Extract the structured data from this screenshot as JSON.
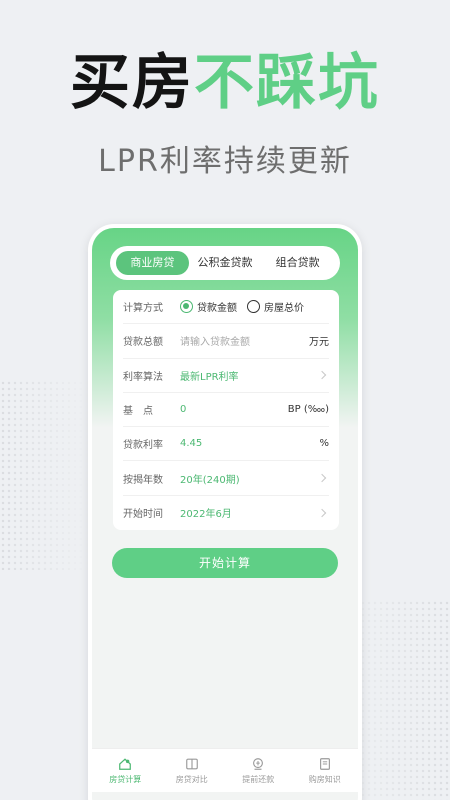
{
  "headline": {
    "part1": "买房",
    "part2": "不踩坑"
  },
  "subheadline": "LPR利率持续更新",
  "colors": {
    "accent": "#5fcf86",
    "accent_dark": "#4cb872",
    "background": "#eef0f3"
  },
  "tabs": [
    {
      "label": "商业房贷",
      "active": true
    },
    {
      "label": "公积金贷款",
      "active": false
    },
    {
      "label": "组合贷款",
      "active": false
    }
  ],
  "form": {
    "calc_method": {
      "label": "计算方式",
      "options": [
        {
          "label": "贷款金额",
          "selected": true
        },
        {
          "label": "房屋总价",
          "selected": false
        }
      ]
    },
    "loan_total": {
      "label": "贷款总额",
      "placeholder": "请输入贷款金额",
      "unit": "万元"
    },
    "rate_algo": {
      "label": "利率算法",
      "value": "最新LPR利率"
    },
    "basis_point": {
      "label": "基　点",
      "value": "0",
      "unit": "BP (‱)"
    },
    "loan_rate": {
      "label": "贷款利率",
      "value": "4.45",
      "unit": "%"
    },
    "years": {
      "label": "按揭年数",
      "value": "20年(240期)"
    },
    "start_time": {
      "label": "开始时间",
      "value": "2022年6月"
    }
  },
  "start_button": "开始计算",
  "bottom_nav": [
    {
      "label": "房贷计算",
      "icon": "house-calc-icon",
      "active": true
    },
    {
      "label": "房贷对比",
      "icon": "compare-icon",
      "active": false
    },
    {
      "label": "提前还款",
      "icon": "prepay-icon",
      "active": false
    },
    {
      "label": "购房知识",
      "icon": "book-icon",
      "active": false
    }
  ]
}
